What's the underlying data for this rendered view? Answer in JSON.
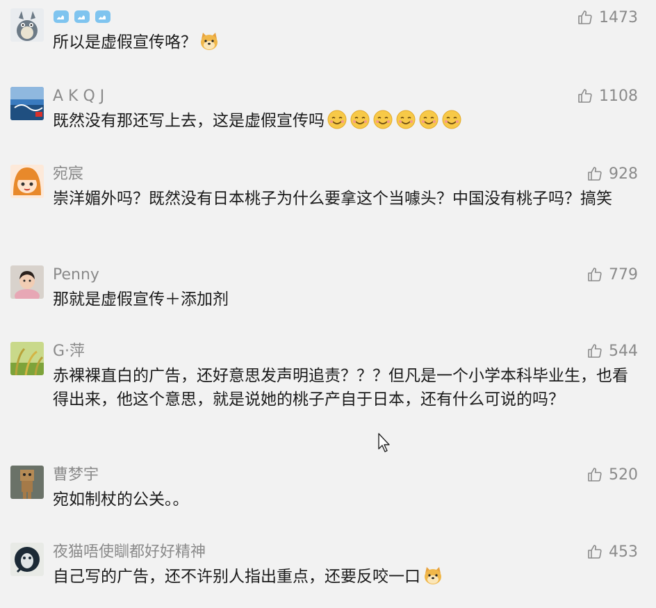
{
  "comments": [
    {
      "name": "",
      "badges": [
        "like-hand-badge",
        "like-hand-badge",
        "like-hand-badge"
      ],
      "likes": "1473",
      "text": "所以是虚假宣传咯？",
      "emojis": [
        "doge-emoji"
      ],
      "avatar": "totoro-avatar"
    },
    {
      "name": "A K Q J",
      "likes": "1108",
      "text": "既然没有那还写上去，这是虚假宣传吗",
      "emojis": [
        "smile-emoji",
        "smile-emoji",
        "smile-emoji",
        "smile-emoji",
        "smile-emoji",
        "smile-emoji"
      ],
      "avatar": "seascape-avatar"
    },
    {
      "name": "宛宸",
      "likes": "928",
      "text": "崇洋媚外吗？既然没有日本桃子为什么要拿这个当噱头？中国没有桃子吗？搞笑",
      "emojis": [],
      "avatar": "anime-girl-avatar"
    },
    {
      "name": "Penny",
      "likes": "779",
      "text": "那就是虚假宣传＋添加剂",
      "emojis": [],
      "avatar": "child-photo-avatar"
    },
    {
      "name": "G·萍",
      "likes": "544",
      "text": "赤裸裸直白的广告，还好意思发声明追责？？？但凡是一个小学本科毕业生，也看得出来，他这个意思，就是说她的桃子产自于日本，还有什么可说的吗？",
      "emojis": [],
      "avatar": "rice-field-avatar"
    },
    {
      "name": "曹梦宇",
      "likes": "520",
      "text": "宛如制杖的公关。。",
      "emojis": [],
      "avatar": "box-robot-avatar"
    },
    {
      "name": "夜猫唔使瞓都好好精神",
      "likes": "453",
      "text": "自己写的广告，还不许别人指出重点，还要反咬一口",
      "emojis": [
        "doge-emoji"
      ],
      "avatar": "night-owl-avatar"
    }
  ],
  "colors": {
    "background": "#f2f2f2",
    "meta_text": "#8a8a8a",
    "body_text": "#1a1a1a"
  }
}
